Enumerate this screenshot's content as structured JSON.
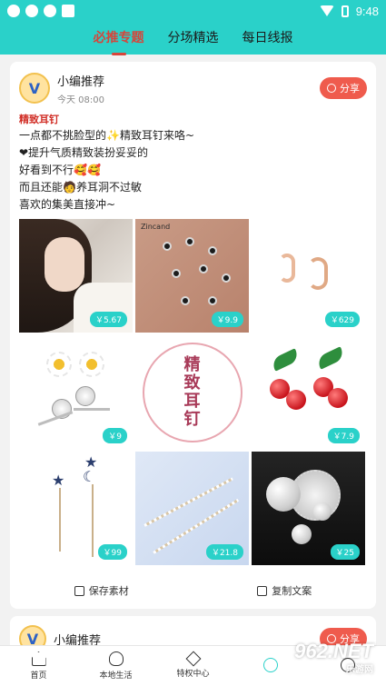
{
  "statusbar": {
    "time": "9:48"
  },
  "tabs": [
    {
      "label": "必推专题",
      "active": true
    },
    {
      "label": "分场精选",
      "active": false
    },
    {
      "label": "每日线报",
      "active": false
    }
  ],
  "post": {
    "author": "小编推荐",
    "time": "今天 08:00",
    "share_label": "分享",
    "tag": "精致耳钉",
    "lines": [
      "一点都不挑脸型的✨精致耳钉来咯~",
      "❤提升气质精致装扮妥妥的",
      "好看到不行🥰🥰",
      "而且还能🧑养耳洞不过敏",
      "喜欢的集美直接冲~"
    ],
    "images": [
      {
        "price": "￥5.67",
        "icon": "model-earring-photo"
      },
      {
        "price": "￥9.9",
        "icon": "stud-set-photo",
        "label": "Zincand"
      },
      {
        "price": "￥629",
        "icon": "gold-hoop-photo"
      },
      {
        "price": "￥9",
        "icon": "daisy-studs-photo"
      },
      {
        "price": "",
        "icon": "tag-badge",
        "badge_text": [
          "精",
          "致",
          "耳",
          "钉"
        ]
      },
      {
        "price": "￥7.9",
        "icon": "cherry-earrings-photo"
      },
      {
        "price": "￥99",
        "icon": "star-moon-dangle-photo"
      },
      {
        "price": "￥21.8",
        "icon": "pearl-strand-photo"
      },
      {
        "price": "￥25",
        "icon": "pearl-studs-photo"
      }
    ],
    "save_label": "保存素材",
    "copy_label": "复制文案"
  },
  "post2": {
    "author": "小编推荐",
    "share_label": "分享"
  },
  "bottom_nav": [
    {
      "label": "首页",
      "icon": "home-icon"
    },
    {
      "label": "本地生活",
      "icon": "hand-icon"
    },
    {
      "label": "特权中心",
      "icon": "diamond-icon"
    },
    {
      "label": "",
      "icon": "favorite-icon"
    },
    {
      "label": "",
      "icon": "user-icon"
    }
  ],
  "watermark": {
    "top": "962.NET",
    "bottom": "乐游网"
  },
  "colors": {
    "accent": "#2ad1c9",
    "red": "#d6453a",
    "share": "#ef5b4d"
  }
}
